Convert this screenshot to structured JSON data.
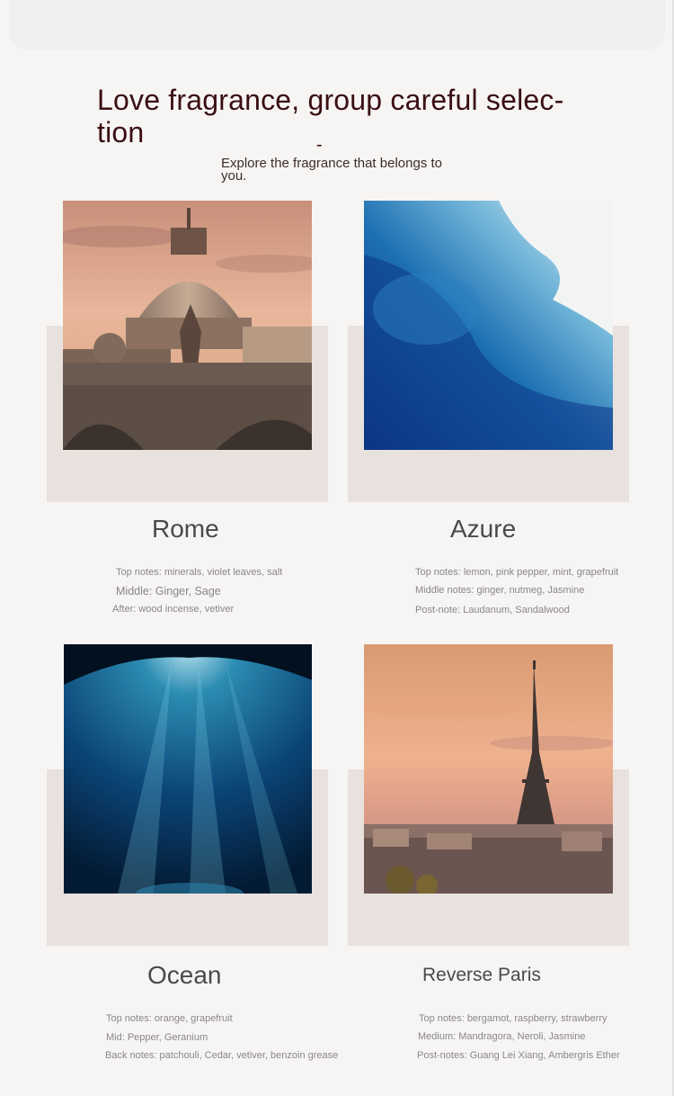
{
  "header": {
    "title": "Love fragrance, group careful selec-\ntion",
    "dash": "-",
    "subtitle": "Explore the fragrance that belongs to you."
  },
  "products": [
    {
      "name": "Rome",
      "image": "rome-dome-photo",
      "notes": [
        "Top notes: minerals, violet leaves, salt",
        "Middle: Ginger, Sage",
        "After: wood incense, vetiver"
      ]
    },
    {
      "name": "Azure",
      "image": "blue-watercolor-photo",
      "notes": [
        "Top notes: lemon, pink pepper, mint, grapefruit",
        "Middle notes: ginger, nutmeg, Jasmine",
        "Post-note: Laudanum, Sandalwood"
      ]
    },
    {
      "name": "Ocean",
      "image": "underwater-light-photo",
      "notes": [
        "Top notes: orange, grapefruit",
        "Mid: Pepper, Geranium",
        "Back notes: patchouli, Cedar, vetiver, benzoin grease"
      ]
    },
    {
      "name": "Reverse Paris",
      "image": "eiffel-tower-photo",
      "notes": [
        "Top notes: bergamot, raspberry, strawberry",
        "Medium: Mandragora, Neroli, Jasmine",
        "Post-notes: Guang Lei Xiang, Ambergris Ether"
      ]
    }
  ],
  "colors": {
    "background": "#f6f5f4",
    "card": "#e9e1de",
    "title": "#3a0f12",
    "name": "#4a4a4a",
    "notes": "#8a8686"
  }
}
